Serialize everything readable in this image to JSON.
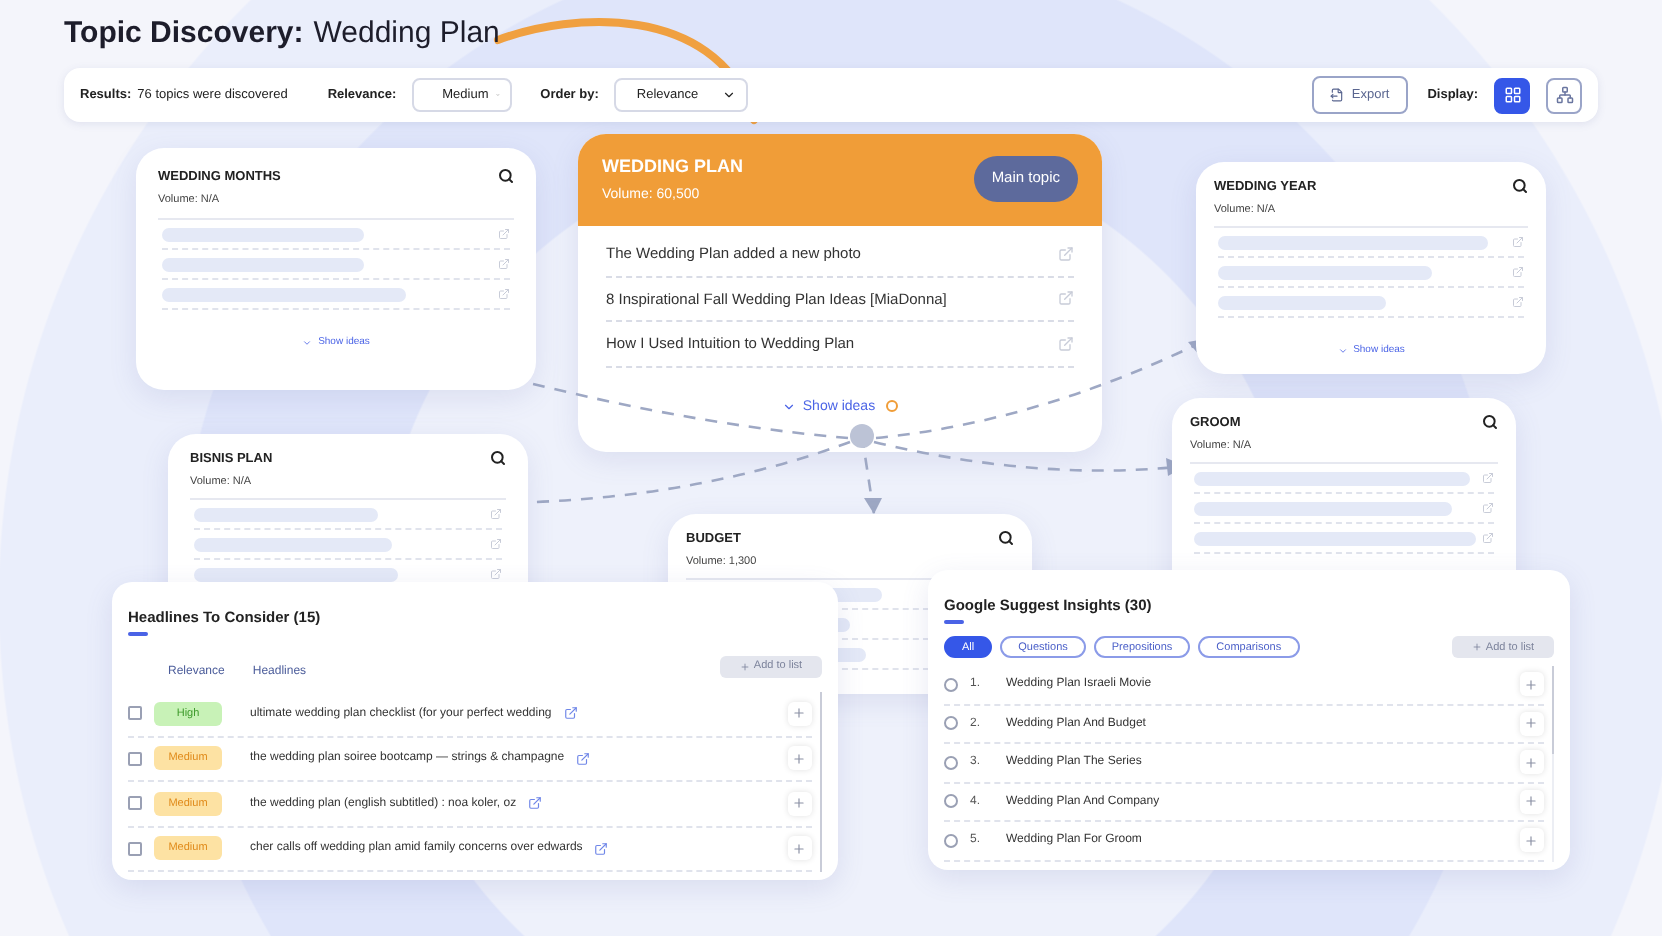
{
  "title": {
    "label": "Topic Discovery:",
    "value": "Wedding Plan"
  },
  "toolbar": {
    "results_label": "Results:",
    "results_text": "76 topics were discovered",
    "relevance_label": "Relevance:",
    "relevance_value": "Medium",
    "order_label": "Order by:",
    "order_value": "Relevance",
    "export": "Export",
    "display_label": "Display:",
    "display_modes": [
      {
        "kind": "grid",
        "selected": true
      },
      {
        "kind": "tree",
        "selected": false
      }
    ]
  },
  "main_topic": {
    "title": "WEDDING PLAN",
    "volume": "Volume: 60,500",
    "badge": "Main topic",
    "ideas": [
      "The Wedding Plan added a new photo",
      "8 Inspirational Fall Wedding Plan Ideas [MiaDonna]",
      "How I Used Intuition to Wedding Plan"
    ],
    "show_ideas": "Show ideas"
  },
  "topic_cards": [
    {
      "title": "WEDDING MONTHS",
      "volume": "Volume: N/A",
      "show_ideas": "Show ideas"
    },
    {
      "title": "WEDDING YEAR",
      "volume": "Volume: N/A",
      "show_ideas": "Show ideas"
    },
    {
      "title": "BISNIS PLAN",
      "volume": "Volume: N/A"
    },
    {
      "title": "GROOM",
      "volume": "Volume: N/A"
    },
    {
      "title": "BUDGET",
      "volume": "Volume: 1,300"
    }
  ],
  "headlines": {
    "title": "Headlines To Consider (15)",
    "columns": [
      "Relevance",
      "Headlines"
    ],
    "add_button": {
      "label": "Add to list",
      "disabled": true
    },
    "rows": [
      {
        "checked": false,
        "kind": "high",
        "relevance": "High",
        "headline": "ultimate wedding plan checklist (for your perfect wedding"
      },
      {
        "checked": false,
        "kind": "medium",
        "relevance": "Medium",
        "headline": "the wedding plan soiree bootcamp — strings & champagne"
      },
      {
        "checked": false,
        "kind": "medium",
        "relevance": "Medium",
        "headline": "the wedding plan (english subtitled) : noa koler, oz"
      },
      {
        "checked": false,
        "kind": "medium",
        "relevance": "Medium",
        "headline": "cher calls off wedding plan amid family concerns over edwards"
      }
    ]
  },
  "google_suggest": {
    "title": "Google Suggest Insights (30)",
    "filters": [
      {
        "label": "All",
        "selected": true
      },
      {
        "label": "Questions",
        "selected": false
      },
      {
        "label": "Prepositions",
        "selected": false
      },
      {
        "label": "Comparisons",
        "selected": false
      }
    ],
    "add_button": {
      "label": "Add to list",
      "disabled": true
    },
    "rows": [
      {
        "checked": false,
        "number": "1.",
        "text": "Wedding Plan Israeli Movie"
      },
      {
        "checked": false,
        "number": "2.",
        "text": "Wedding Plan And Budget"
      },
      {
        "checked": false,
        "number": "3.",
        "text": "Wedding Plan The Series"
      },
      {
        "checked": false,
        "number": "4.",
        "text": "Wedding Plan And Company"
      },
      {
        "checked": false,
        "number": "5.",
        "text": "Wedding Plan For Groom"
      }
    ]
  }
}
